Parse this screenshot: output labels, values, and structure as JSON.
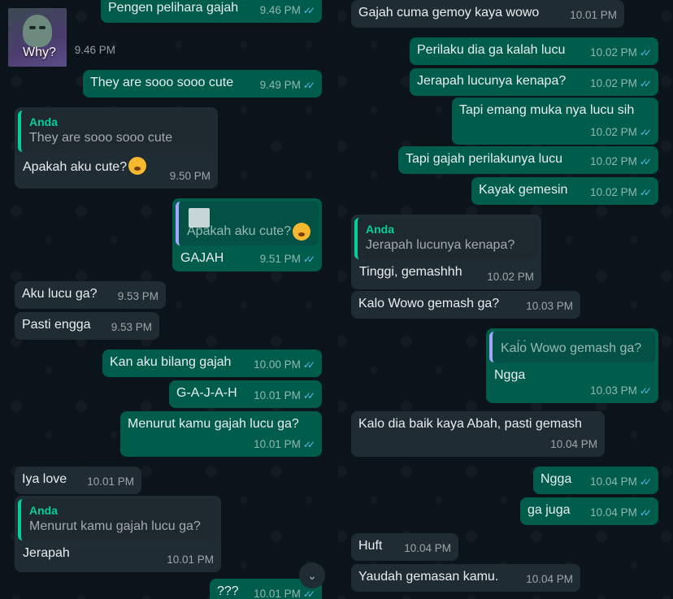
{
  "chat": {
    "avatar": {
      "label": "Why?"
    },
    "left": [
      {
        "id": "l1",
        "dir": "out",
        "text": "Pengen pelihara gajah",
        "time": "9.46 PM",
        "ticks": true
      },
      {
        "id": "l2",
        "dir": "in",
        "text": "",
        "time": "9.46 PM"
      },
      {
        "id": "l3",
        "dir": "out",
        "text": "They are sooo sooo cute",
        "time": "9.49 PM",
        "ticks": true
      },
      {
        "id": "l4",
        "dir": "in",
        "quote_author": "Anda",
        "quote_text": "They are sooo sooo cute",
        "text": "Apakah aku cute?",
        "time": "9.50 PM",
        "emoji": "flushed-emoji"
      },
      {
        "id": "l5",
        "dir": "out",
        "quote_text": "Apakah aku cute?",
        "text": "GAJAH",
        "time": "9.51 PM",
        "ticks": true,
        "emoji": "flushed-emoji"
      },
      {
        "id": "l6",
        "dir": "in",
        "text": "Aku lucu ga?",
        "time": "9.53 PM"
      },
      {
        "id": "l7",
        "dir": "in",
        "text": "Pasti engga",
        "time": "9.53 PM"
      },
      {
        "id": "l8",
        "dir": "out",
        "text": "Kan aku bilang gajah",
        "time": "10.00 PM",
        "ticks": true
      },
      {
        "id": "l9",
        "dir": "out",
        "text": "G-A-J-A-H",
        "time": "10.01 PM",
        "ticks": true
      },
      {
        "id": "l10",
        "dir": "out",
        "text": "Menurut kamu gajah lucu ga?",
        "time": "10.01 PM",
        "ticks": true
      },
      {
        "id": "l11",
        "dir": "in",
        "text": "Iya love",
        "time": "10.01 PM"
      },
      {
        "id": "l12",
        "dir": "in",
        "quote_author": "Anda",
        "quote_text": "Menurut kamu gajah lucu ga?",
        "text": "Jerapah",
        "time": "10.01 PM"
      },
      {
        "id": "l13",
        "dir": "out",
        "text": "???",
        "time": "10.01 PM",
        "ticks": true
      }
    ],
    "right": [
      {
        "id": "r1",
        "dir": "in",
        "text": "Gajah cuma gemoy kaya wowo",
        "time": "10.01 PM"
      },
      {
        "id": "r2",
        "dir": "out",
        "text": "Perilaku dia ga kalah lucu",
        "time": "10.02 PM",
        "ticks": true
      },
      {
        "id": "r3",
        "dir": "out",
        "text": "Jerapah lucunya kenapa?",
        "time": "10.02 PM",
        "ticks": true
      },
      {
        "id": "r4",
        "dir": "out",
        "text": "Tapi emang muka nya lucu sih",
        "time": "10.02 PM",
        "ticks": true
      },
      {
        "id": "r5",
        "dir": "out",
        "text": "Tapi gajah perilakunya lucu",
        "time": "10.02 PM",
        "ticks": true
      },
      {
        "id": "r6",
        "dir": "out",
        "text": "Kayak gemesin",
        "time": "10.02 PM",
        "ticks": true
      },
      {
        "id": "r7",
        "dir": "in",
        "quote_author": "Anda",
        "quote_text": "Jerapah lucunya kenapa?",
        "text": "Tinggi, gemashhh",
        "time": "10.02 PM"
      },
      {
        "id": "r8",
        "dir": "in",
        "text": "Kalo Wowo gemash ga?",
        "time": "10.03 PM"
      },
      {
        "id": "r9",
        "dir": "out",
        "quote_text": "Kalo Wowo gemash ga?",
        "text": "Ngga",
        "time": "10.03 PM",
        "ticks": true
      },
      {
        "id": "r10",
        "dir": "in",
        "text": "Kalo dia baik kaya Abah, pasti gemash",
        "time": "10.04 PM"
      },
      {
        "id": "r11",
        "dir": "out",
        "text": "Ngga",
        "time": "10.04 PM",
        "ticks": true
      },
      {
        "id": "r12",
        "dir": "out",
        "text": "ga juga",
        "time": "10.04 PM",
        "ticks": true
      },
      {
        "id": "r13",
        "dir": "in",
        "text": "Huft",
        "time": "10.04 PM"
      },
      {
        "id": "r14",
        "dir": "in",
        "text": "Yaudah gemasan kamu.",
        "time": "10.04 PM"
      }
    ]
  },
  "colors": {
    "background": "#0b141a",
    "incoming_bubble": "#202c33",
    "outgoing_bubble": "#005c4b",
    "quote_accent": "#06cf9c",
    "read_ticks": "#53bdeb"
  },
  "icons": {
    "read_ticks": "double-check-icon",
    "scroll_down": "chevron-down-icon"
  }
}
